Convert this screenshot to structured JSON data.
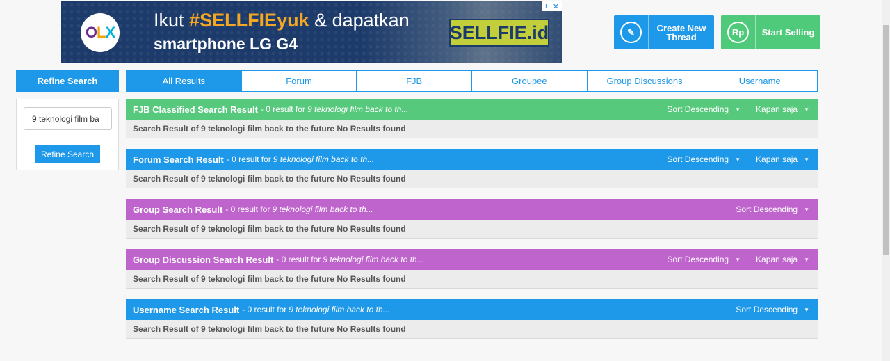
{
  "ad": {
    "logo": {
      "o1": "O",
      "l": "L",
      "x": "X"
    },
    "text_prefix": "Ikut",
    "hashtag": "#SELLFIEyuk",
    "text_suffix": "& dapatkan",
    "line2": "smartphone LG G4",
    "badge": "SELLFIE.id",
    "adchoice_info": "i",
    "adchoice_close": "✕"
  },
  "header_buttons": {
    "create": {
      "label": "Create New Thread",
      "icon_glyph": "✎"
    },
    "sell": {
      "label": "Start Selling",
      "icon_glyph": "Rp"
    }
  },
  "sidebar": {
    "title": "Refine Search",
    "query_value": "9 teknologi film ba",
    "button_label": "Refine Search"
  },
  "tabs": [
    {
      "label": "All Results",
      "active": true
    },
    {
      "label": "Forum"
    },
    {
      "label": "FJB"
    },
    {
      "label": "Groupee"
    },
    {
      "label": "Group Discussions"
    },
    {
      "label": "Username"
    }
  ],
  "sections": [
    {
      "title": "FJB Classified Search Result",
      "meta": "- 0 result for",
      "query": "9 teknologi film back to th...",
      "sort_label": "Sort Descending",
      "time_label": "Kapan saja",
      "body": "Search Result of 9 teknologi film back to the future No Results found",
      "color": "#57c97c"
    },
    {
      "title": "Forum Search Result",
      "meta": "- 0 result for",
      "query": "9 teknologi film back to th...",
      "sort_label": "Sort Descending",
      "time_label": "Kapan saja",
      "body": "Search Result of 9 teknologi film back to the future No Results found",
      "color": "#1e98e8"
    },
    {
      "title": "Group Search Result",
      "meta": "- 0 result for",
      "query": "9 teknologi film back to th...",
      "sort_label": "Sort Descending",
      "body": "Search Result of 9 teknologi film back to the future No Results found",
      "color": "#bf64cd"
    },
    {
      "title": "Group Discussion Search Result",
      "meta": "- 0 result for",
      "query": "9 teknologi film back to th...",
      "sort_label": "Sort Descending",
      "time_label": "Kapan saja",
      "body": "Search Result of 9 teknologi film back to the future No Results found",
      "color": "#bf64cd"
    },
    {
      "title": "Username Search Result",
      "meta": "- 0 result for",
      "query": "9 teknologi film back to th...",
      "sort_label": "Sort Descending",
      "body": "Search Result of 9 teknologi film back to the future No Results found",
      "color": "#1e98e8"
    }
  ],
  "icons": {
    "caret": "caret-down-icon",
    "pencil": "pencil-icon",
    "rupiah": "rupiah-icon"
  }
}
